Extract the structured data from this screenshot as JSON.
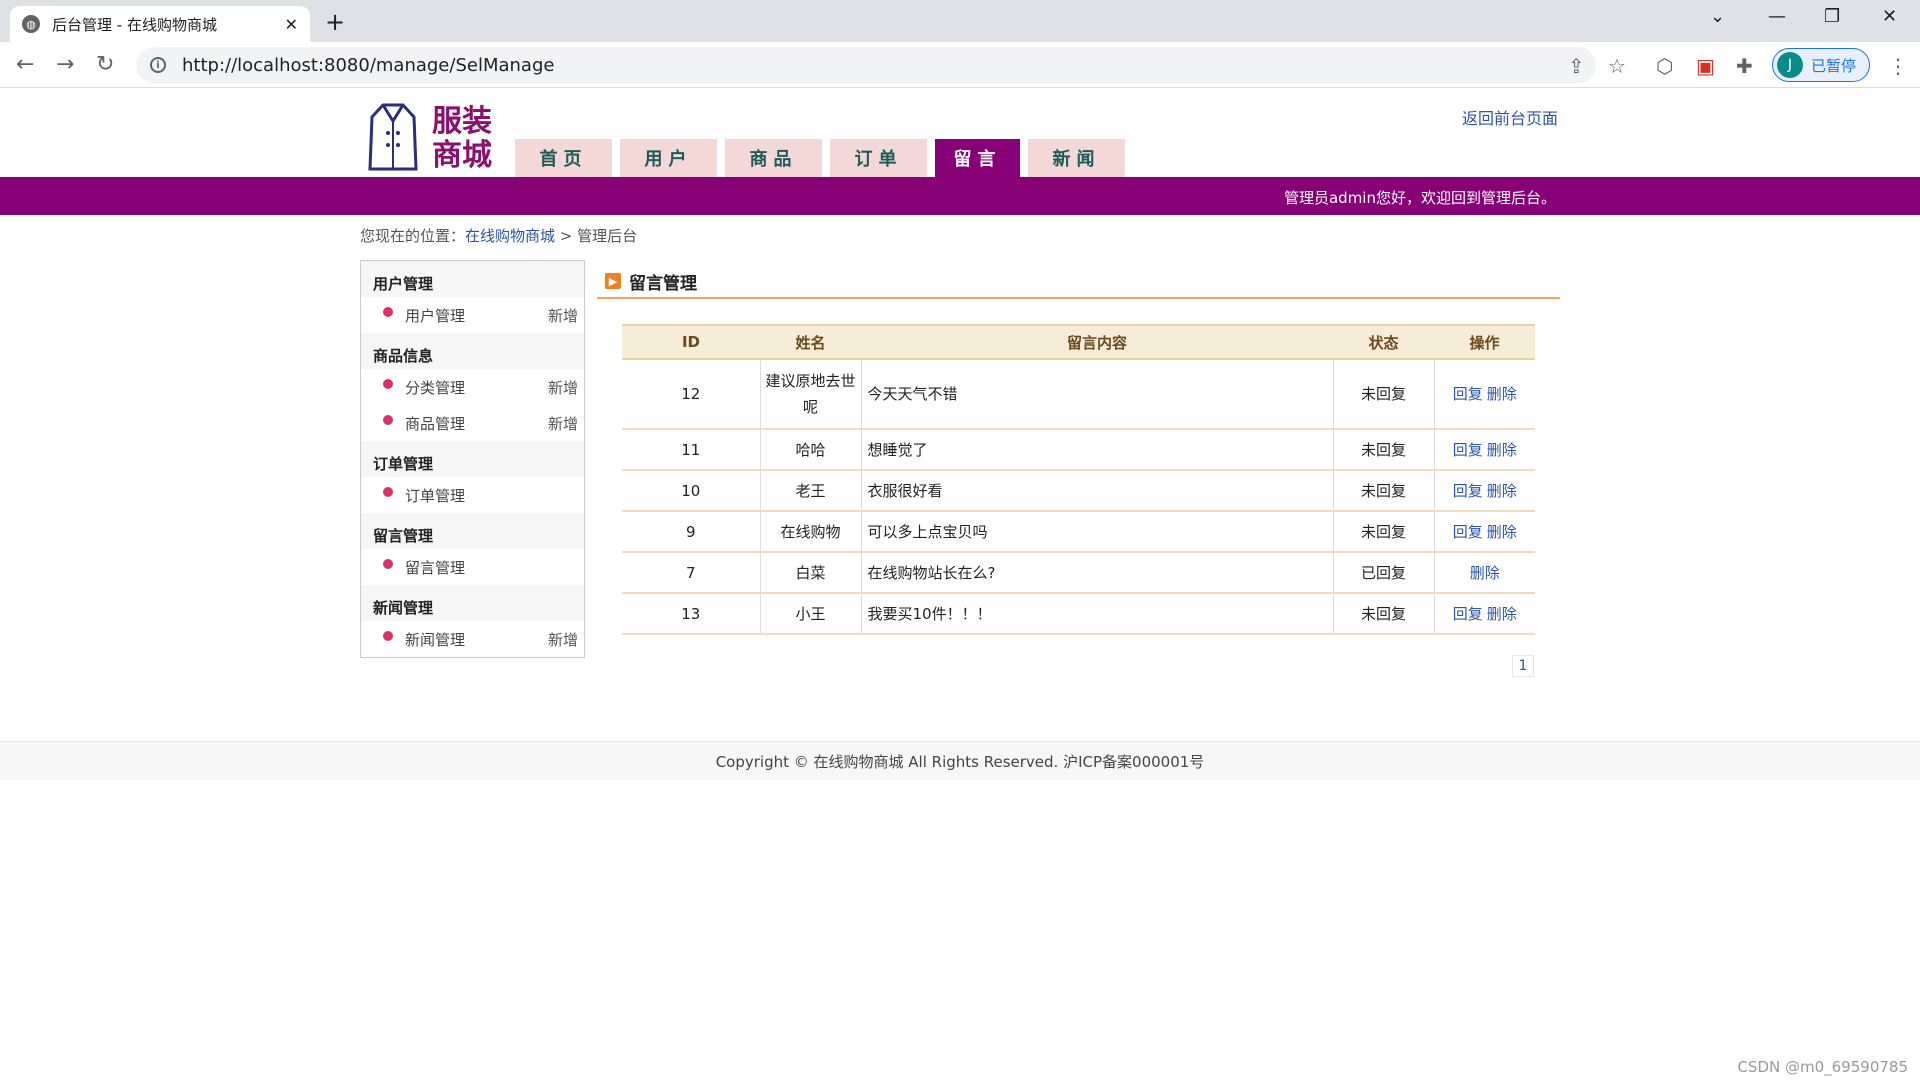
{
  "browser": {
    "tab_title": "后台管理 - 在线购物商城",
    "url": "http://localhost:8080/manage/SelManage",
    "profile_initial": "J",
    "profile_status": "已暂停"
  },
  "header": {
    "logo_text_line1": "服装",
    "logo_text_line2": "商城",
    "top_link": "返回前台页面",
    "nav": [
      "首页",
      "用户",
      "商品",
      "订单",
      "留言",
      "新闻"
    ],
    "active_nav_index": 4,
    "welcome": "管理员admin您好，欢迎回到管理后台。"
  },
  "breadcrumb": {
    "prefix": "您现在的位置：",
    "home": "在线购物商城",
    "sep": " > ",
    "current": "管理后台"
  },
  "sidebar": {
    "sections": [
      {
        "title": "用户管理",
        "items": [
          {
            "label": "用户管理",
            "add": "新增"
          }
        ]
      },
      {
        "title": "商品信息",
        "items": [
          {
            "label": "分类管理",
            "add": "新增"
          },
          {
            "label": "商品管理",
            "add": "新增"
          }
        ]
      },
      {
        "title": "订单管理",
        "items": [
          {
            "label": "订单管理",
            "add": ""
          }
        ]
      },
      {
        "title": "留言管理",
        "items": [
          {
            "label": "留言管理",
            "add": ""
          }
        ]
      },
      {
        "title": "新闻管理",
        "items": [
          {
            "label": "新闻管理",
            "add": "新增"
          }
        ]
      }
    ]
  },
  "main": {
    "title": "留言管理",
    "columns": [
      "ID",
      "姓名",
      "留言内容",
      "状态",
      "操作"
    ],
    "rows": [
      {
        "id": "12",
        "name": "建议原地去世呢",
        "content": "今天天气不错",
        "status": "未回复",
        "reply": "回复",
        "delete": "删除"
      },
      {
        "id": "11",
        "name": "哈哈",
        "content": "想睡觉了",
        "status": "未回复",
        "reply": "回复",
        "delete": "删除"
      },
      {
        "id": "10",
        "name": "老王",
        "content": "衣服很好看",
        "status": "未回复",
        "reply": "回复",
        "delete": "删除"
      },
      {
        "id": "9",
        "name": "在线购物",
        "content": "可以多上点宝贝吗",
        "status": "未回复",
        "reply": "回复",
        "delete": "删除"
      },
      {
        "id": "7",
        "name": "白菜",
        "content": "在线购物站长在么?",
        "status": "已回复",
        "reply": "",
        "delete": "删除"
      },
      {
        "id": "13",
        "name": "小王",
        "content": "我要买10件！！！",
        "status": "未回复",
        "reply": "回复",
        "delete": "删除"
      }
    ],
    "page": "1"
  },
  "footer": "Copyright © 在线购物商城 All Rights Reserved. 沪ICP备案000001号",
  "watermark": "CSDN @m0_69590785"
}
